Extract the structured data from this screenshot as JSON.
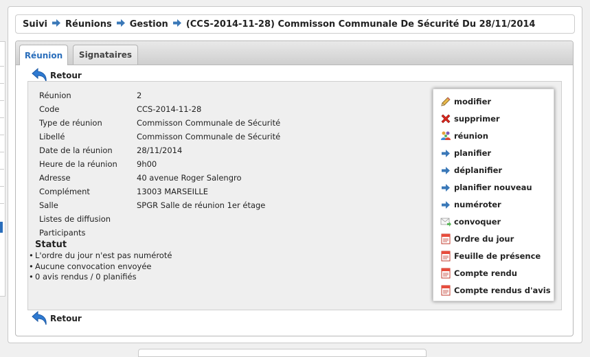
{
  "breadcrumb": {
    "items": [
      "Suivi",
      "Réunions",
      "Gestion"
    ],
    "current": "(CCS-2014-11-28) Commisson Communale De Sécurité Du 28/11/2014"
  },
  "tabs": [
    {
      "label": "Réunion"
    },
    {
      "label": "Signataires"
    }
  ],
  "back_label": "Retour",
  "fields": [
    {
      "label": "Réunion",
      "value": "2"
    },
    {
      "label": "Code",
      "value": "CCS-2014-11-28"
    },
    {
      "label": "Type de réunion",
      "value": "Commisson Communale de Sécurité"
    },
    {
      "label": "Libellé",
      "value": "Commisson Communale de Sécurité"
    },
    {
      "label": "Date de la réunion",
      "value": "28/11/2014"
    },
    {
      "label": "Heure de la réunion",
      "value": "9h00"
    },
    {
      "label": "Adresse",
      "value": "40 avenue Roger Salengro"
    },
    {
      "label": "Complément",
      "value": "13003 MARSEILLE"
    },
    {
      "label": "Salle",
      "value": "SPGR Salle de réunion 1er étage"
    },
    {
      "label": "Listes de diffusion",
      "value": ""
    },
    {
      "label": "Participants",
      "value": ""
    }
  ],
  "statut": {
    "title": "Statut",
    "items": [
      "L'ordre du jour n'est pas numéroté",
      "Aucune convocation envoyée",
      "0 avis rendus / 0 planifiés"
    ]
  },
  "actions": [
    {
      "label": "modifier",
      "icon": "pencil-icon"
    },
    {
      "label": "supprimer",
      "icon": "delete-icon"
    },
    {
      "label": "réunion",
      "icon": "people-icon"
    },
    {
      "label": "planifier",
      "icon": "arrow-right-icon"
    },
    {
      "label": "déplanifier",
      "icon": "arrow-right-icon"
    },
    {
      "label": "planifier nouveau",
      "icon": "arrow-right-icon"
    },
    {
      "label": "numéroter",
      "icon": "arrow-right-icon"
    },
    {
      "label": "convoquer",
      "icon": "mail-icon"
    },
    {
      "label": "Ordre du jour",
      "icon": "pdf-icon"
    },
    {
      "label": "Feuille de présence",
      "icon": "pdf-icon"
    },
    {
      "label": "Compte rendu",
      "icon": "pdf-icon"
    },
    {
      "label": "Compte rendus d'avis",
      "icon": "pdf-icon"
    }
  ],
  "colors": {
    "accent": "#2a6ebb",
    "arrow": "#3a78b8",
    "delete": "#d9261c"
  }
}
